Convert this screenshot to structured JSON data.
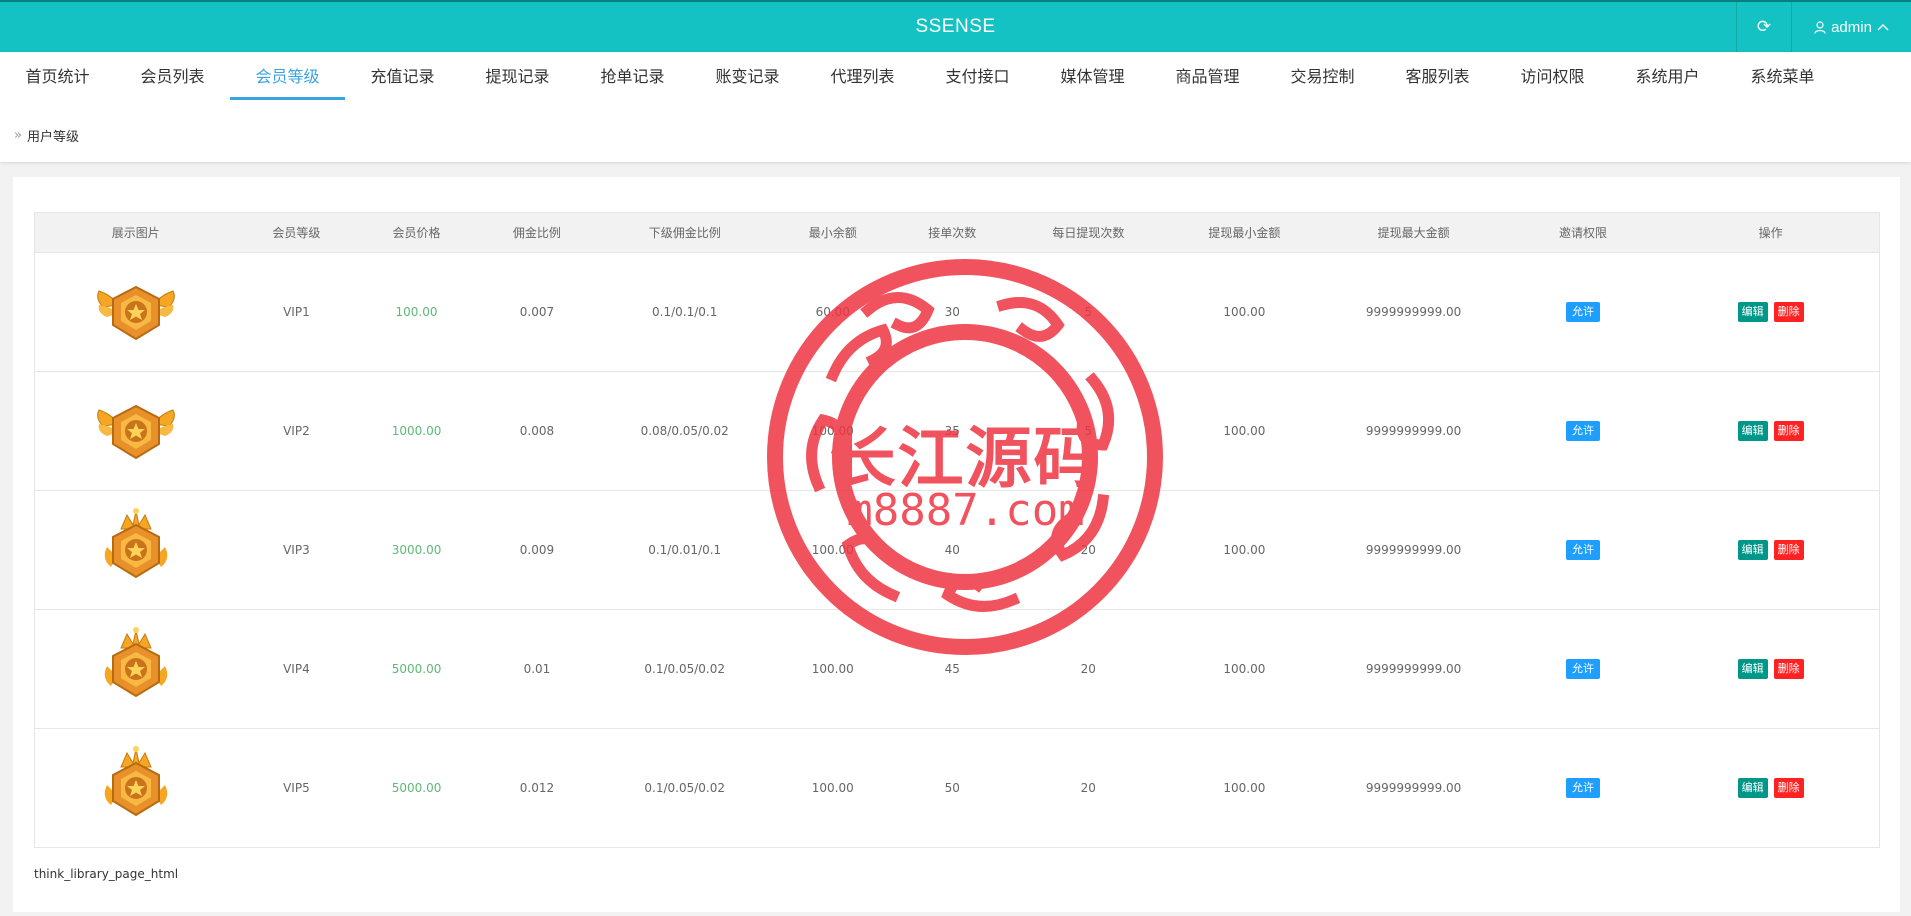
{
  "header": {
    "title": "SSENSE",
    "username": "admin"
  },
  "nav": {
    "tabs": [
      {
        "label": "首页统计"
      },
      {
        "label": "会员列表"
      },
      {
        "label": "会员等级"
      },
      {
        "label": "充值记录"
      },
      {
        "label": "提现记录"
      },
      {
        "label": "抢单记录"
      },
      {
        "label": "账变记录"
      },
      {
        "label": "代理列表"
      },
      {
        "label": "支付接口"
      },
      {
        "label": "媒体管理"
      },
      {
        "label": "商品管理"
      },
      {
        "label": "交易控制"
      },
      {
        "label": "客服列表"
      },
      {
        "label": "访问权限"
      },
      {
        "label": "系统用户"
      },
      {
        "label": "系统菜单"
      }
    ],
    "active_index": 2
  },
  "breadcrumb": {
    "label": "用户等级"
  },
  "table": {
    "columns": [
      "展示图片",
      "会员等级",
      "会员价格",
      "佣金比例",
      "下级佣金比例",
      "最小余额",
      "接单次数",
      "每日提现次数",
      "提现最小金额",
      "提现最大金额",
      "邀请权限",
      "操作"
    ],
    "rows": [
      {
        "level": "VIP1",
        "price": "100.00",
        "commission": "0.007",
        "sub_commission": "0.1/0.1/0.1",
        "min_balance": "60.00",
        "orders": "30",
        "daily_withdraw": "5",
        "withdraw_min": "100.00",
        "withdraw_max": "9999999999.00",
        "invite": "允许",
        "medal": "winged"
      },
      {
        "level": "VIP2",
        "price": "1000.00",
        "commission": "0.008",
        "sub_commission": "0.08/0.05/0.02",
        "min_balance": "100.00",
        "orders": "35",
        "daily_withdraw": "5",
        "withdraw_min": "100.00",
        "withdraw_max": "9999999999.00",
        "invite": "允许",
        "medal": "winged"
      },
      {
        "level": "VIP3",
        "price": "3000.00",
        "commission": "0.009",
        "sub_commission": "0.1/0.01/0.1",
        "min_balance": "100.00",
        "orders": "40",
        "daily_withdraw": "20",
        "withdraw_min": "100.00",
        "withdraw_max": "9999999999.00",
        "invite": "允许",
        "medal": "crowned"
      },
      {
        "level": "VIP4",
        "price": "5000.00",
        "commission": "0.01",
        "sub_commission": "0.1/0.05/0.02",
        "min_balance": "100.00",
        "orders": "45",
        "daily_withdraw": "20",
        "withdraw_min": "100.00",
        "withdraw_max": "9999999999.00",
        "invite": "允许",
        "medal": "crowned"
      },
      {
        "level": "VIP5",
        "price": "5000.00",
        "commission": "0.012",
        "sub_commission": "0.1/0.05/0.02",
        "min_balance": "100.00",
        "orders": "50",
        "daily_withdraw": "20",
        "withdraw_min": "100.00",
        "withdraw_max": "9999999999.00",
        "invite": "允许",
        "medal": "crowned"
      }
    ],
    "edit_label": "编辑",
    "delete_label": "删除"
  },
  "pager": {
    "text": "think_library_page_html"
  },
  "watermark": {
    "title": "长江源码",
    "url": "m8887.com"
  },
  "colors": {
    "topbar": "#14c2c3",
    "active_tab": "#3aa3e3",
    "price": "#5fb878",
    "allow_badge": "#1e9fff",
    "edit_button": "#009688",
    "delete_button": "#ff2222",
    "watermark": "#ee3542"
  }
}
